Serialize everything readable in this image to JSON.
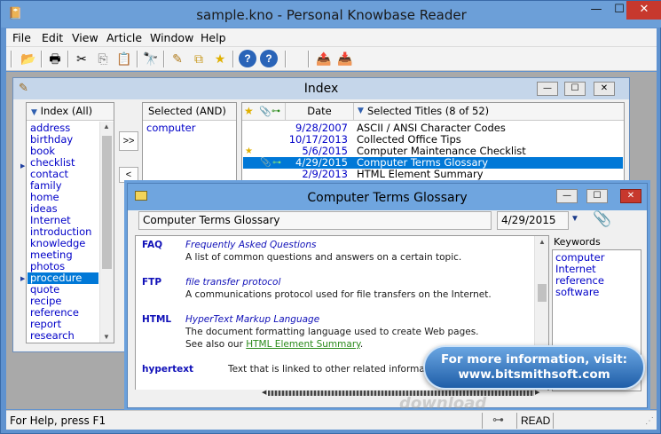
{
  "app": {
    "title": "sample.kno - Personal Knowbase Reader",
    "minimize": "—",
    "maximize": "☐",
    "close": "✕"
  },
  "menu": [
    "File",
    "Edit",
    "View",
    "Article",
    "Window",
    "Help"
  ],
  "toolbar": {
    "icons": [
      "open-folder-icon",
      "print-icon",
      "cut-icon",
      "copy-icon",
      "paste-icon",
      "find-icon",
      "filter-icon",
      "links-icon",
      "favorite-star-icon",
      "help-icon",
      "context-help-icon",
      "export-icon",
      "import-icon"
    ]
  },
  "index_window": {
    "title": "Index",
    "keyword_list": {
      "header": "Index (All)",
      "items": [
        "address",
        "birthday",
        "book",
        "checklist",
        "contact",
        "family",
        "home",
        "ideas",
        "Internet",
        "introduction",
        "knowledge",
        "meeting",
        "photos",
        "procedure",
        "quote",
        "recipe",
        "reference",
        "report",
        "research"
      ],
      "selected_index": 13
    },
    "add_button": ">>",
    "remove_button": "<",
    "selected_list": {
      "header": "Selected (AND)",
      "items": [
        "computer"
      ]
    },
    "titles_table": {
      "date_header": "Date",
      "titles_header": "Selected Titles (8 of 52)",
      "rows": [
        {
          "date": "9/28/2007",
          "title": "ASCII / ANSI Character Codes",
          "star": false,
          "clip": false,
          "link": false
        },
        {
          "date": "10/17/2013",
          "title": "Collected Office Tips",
          "star": false,
          "clip": false,
          "link": false
        },
        {
          "date": "5/6/2015",
          "title": "Computer Maintenance Checklist",
          "star": true,
          "clip": false,
          "link": false
        },
        {
          "date": "4/29/2015",
          "title": "Computer Terms Glossary",
          "star": false,
          "clip": true,
          "link": true
        },
        {
          "date": "2/9/2013",
          "title": "HTML Element Summary",
          "star": false,
          "clip": false,
          "link": false
        }
      ],
      "selected_index": 3
    }
  },
  "topic_window": {
    "title": "Computer Terms Glossary",
    "title_field": "Computer Terms Glossary",
    "date_field": "4/29/2015",
    "dropdown_arrow": "▼",
    "watermark": "download",
    "entries": [
      {
        "term": "FAQ",
        "expansion": "Frequently Asked Questions",
        "definition": "A list of common questions and answers on a certain topic."
      },
      {
        "term": "FTP",
        "expansion": "file transfer protocol",
        "definition": "A communications protocol used for file transfers on the Internet."
      },
      {
        "term": "HTML",
        "expansion": "HyperText Markup Language",
        "definition": "The document formatting language used to create Web pages.",
        "see_also_prefix": "See also our ",
        "see_also_link": "HTML Element Summary",
        "see_also_suffix": "."
      },
      {
        "term": "hypertext",
        "definition": "Text that is linked to other related information."
      }
    ],
    "keywords_label": "Keywords",
    "keywords": [
      "computer",
      "Internet",
      "reference",
      "software"
    ]
  },
  "promo": {
    "line1": "For more information, visit:",
    "line2": "www.bitsmithsoft.com"
  },
  "statusbar": {
    "text": "For Help, press F1",
    "mode": "READ"
  },
  "colors": {
    "accent_blue": "#0078d7",
    "link_blue": "#0000c8",
    "link_green": "#2a8a1a",
    "title_blue": "#6c9fd8"
  }
}
